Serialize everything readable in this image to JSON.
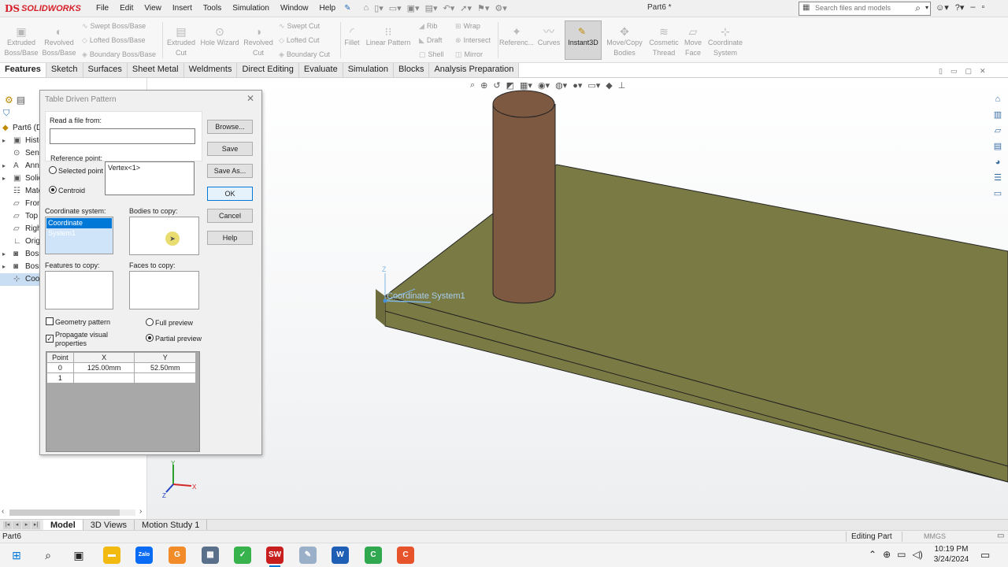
{
  "app": {
    "brand_ds": "DS",
    "brand_name": "SOLIDWORKS",
    "doc_title": "Part6 *"
  },
  "menu": [
    "File",
    "Edit",
    "View",
    "Insert",
    "Tools",
    "Simulation",
    "Window",
    "Help"
  ],
  "search": {
    "placeholder": "Search files and models"
  },
  "commands": {
    "extruded_boss": "Extruded Boss/Base",
    "revolved_boss": "Revolved Boss/Base",
    "swept_boss": "Swept Boss/Base",
    "lofted_boss": "Lofted Boss/Base",
    "boundary_boss": "Boundary Boss/Base",
    "extruded_cut": "Extruded Cut",
    "hole_wizard": "Hole Wizard",
    "revolved_cut": "Revolved Cut",
    "swept_cut": "Swept Cut",
    "lofted_cut": "Lofted Cut",
    "boundary_cut": "Boundary Cut",
    "fillet": "Fillet",
    "linear_pattern": "Linear Pattern",
    "rib": "Rib",
    "draft": "Draft",
    "shell": "Shell",
    "wrap": "Wrap",
    "intersect": "Intersect",
    "mirror": "Mirror",
    "reference": "Referenc...",
    "curves": "Curves",
    "instant3d": "Instant3D",
    "move_copy": "Move/Copy Bodies",
    "cosmetic_thread": "Cosmetic Thread",
    "move_face": "Move Face",
    "coordinate_system": "Coordinate System"
  },
  "tabs": [
    "Features",
    "Sketch",
    "Surfaces",
    "Sheet Metal",
    "Weldments",
    "Direct Editing",
    "Evaluate",
    "Simulation",
    "Blocks",
    "Analysis Preparation"
  ],
  "tree": {
    "root": "Part6 (D",
    "items": [
      "Histo",
      "Sens",
      "Anno",
      "Solid",
      "Mate",
      "Front",
      "Top P",
      "Right",
      "Origi",
      "Boss",
      "Boss",
      "Coor"
    ]
  },
  "dialog": {
    "title": "Table Driven Pattern",
    "read_file_label": "Read a file from:",
    "read_file_value": "",
    "browse": "Browse...",
    "save": "Save",
    "save_as": "Save As...",
    "ok": "OK",
    "cancel": "Cancel",
    "help": "Help",
    "reference_point_label": "Reference point:",
    "selected_point": "Selected point",
    "centroid": "Centroid",
    "reference_point_value": "Vertex<1>",
    "coordinate_system_label": "Coordinate system:",
    "coordinate_system_value": "Coordinate System1",
    "bodies_label": "Bodies to copy:",
    "features_label": "Features to copy:",
    "faces_label": "Faces to copy:",
    "geometry_pattern": "Geometry pattern",
    "propagate_visual": "Propagate visual properties",
    "full_preview": "Full preview",
    "partial_preview": "Partial preview",
    "table": {
      "headers": [
        "Point",
        "X",
        "Y"
      ],
      "rows": [
        [
          "0",
          "125.00mm",
          "52.50mm"
        ],
        [
          "1",
          "",
          ""
        ]
      ]
    }
  },
  "viewport": {
    "cs_label": "Coordinate System1",
    "axis_z": "Z",
    "triad_x": "X",
    "triad_y": "Y",
    "triad_z": "Z"
  },
  "bottom_tabs": [
    "Model",
    "3D Views",
    "Motion Study 1"
  ],
  "status": {
    "left": "Part6",
    "editing": "Editing Part",
    "units": "MMGS"
  },
  "taskbar": {
    "time": "10:19 PM",
    "date": "3/24/2024",
    "zalo": "Zalo"
  },
  "colors": {
    "plate": "#7a7a45",
    "cylinder": "#7d5942",
    "selection": "#0078d7"
  }
}
